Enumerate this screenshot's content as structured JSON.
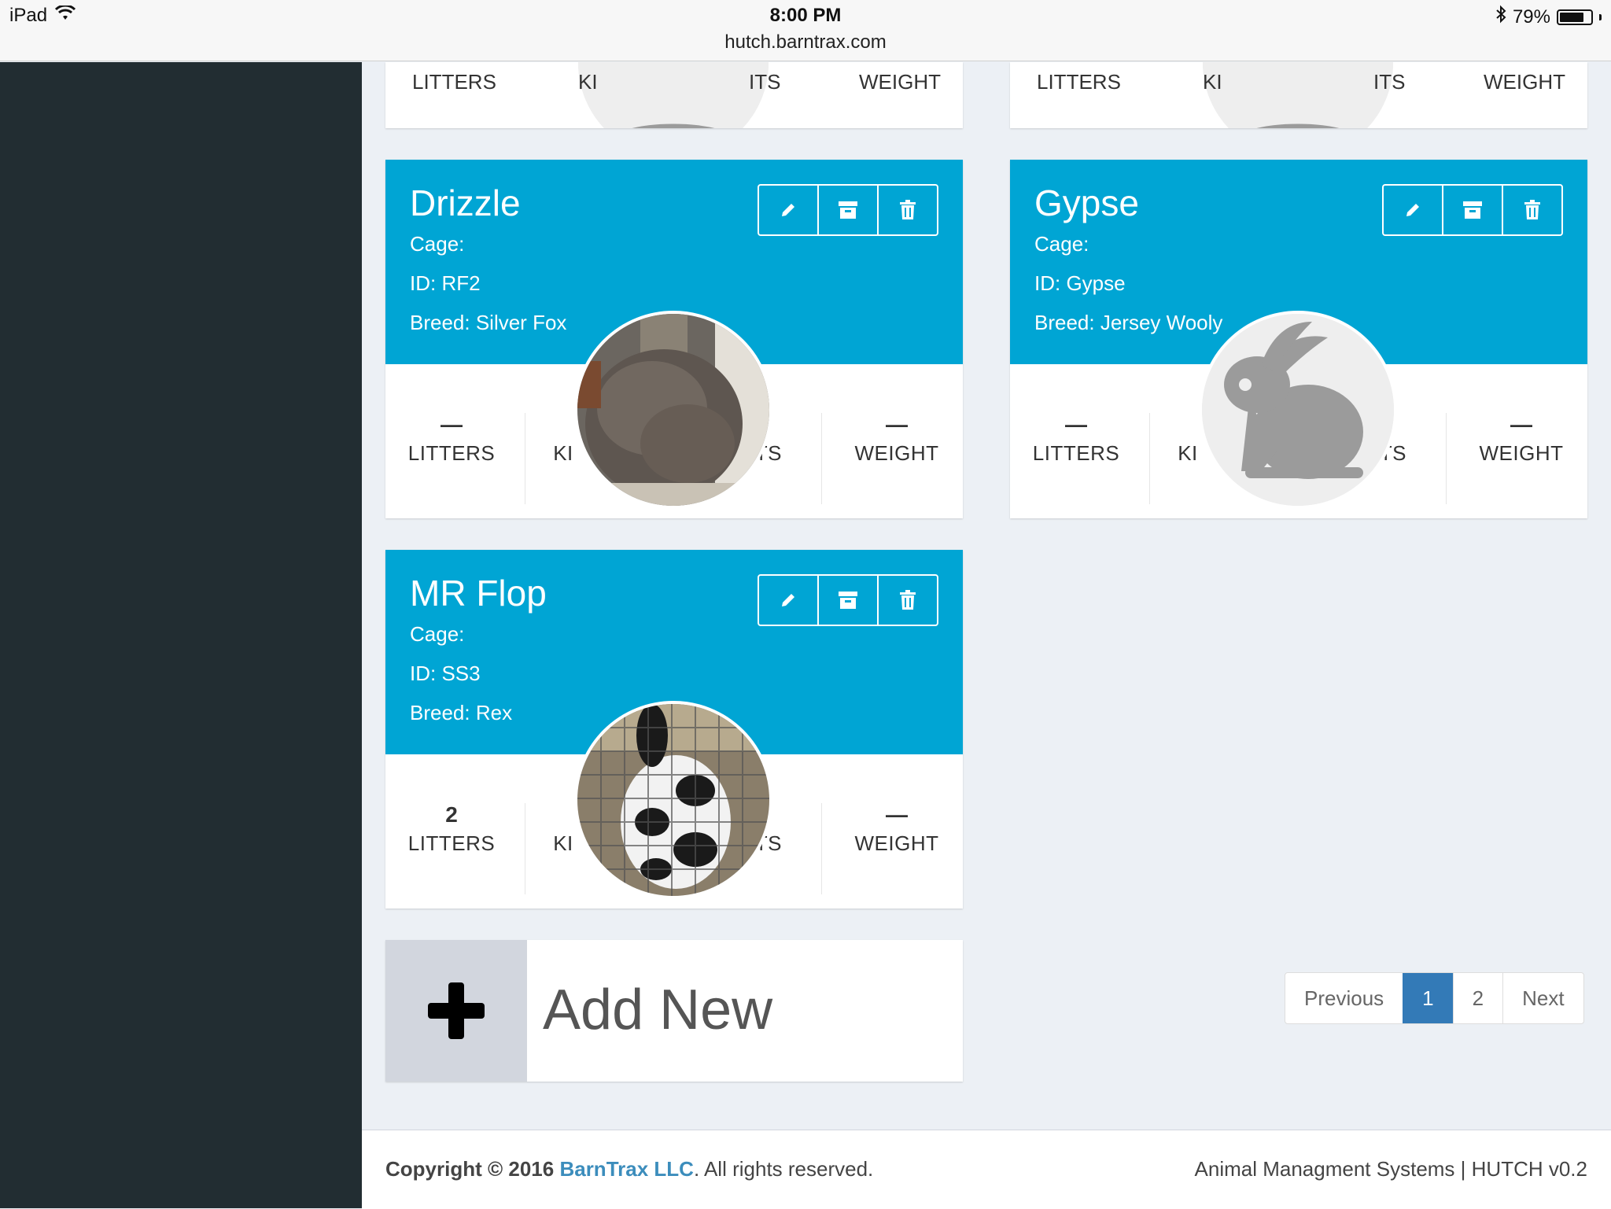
{
  "status_bar": {
    "device": "iPad",
    "time": "8:00 PM",
    "url": "hutch.barntrax.com",
    "battery_percent_label": "79%",
    "battery_level": 0.79
  },
  "stat_labels": {
    "litters": "LITTERS",
    "kits": "KITS",
    "weight": "WEIGHT"
  },
  "partial_cards": [
    {
      "litters": "LITTERS",
      "kits_left": "KI",
      "kits_right": "ITS",
      "weight": "WEIGHT"
    },
    {
      "litters": "LITTERS",
      "kits_left": "KI",
      "kits_right": "ITS",
      "weight": "WEIGHT"
    }
  ],
  "cards": [
    {
      "name": "Drizzle",
      "cage": "Cage:",
      "id": "ID: RF2",
      "breed": "Breed: Silver Fox",
      "litters_value": "—",
      "weight_value": "—",
      "kits_left": "KI",
      "kits_right": "ITS",
      "photo": "brown-fluffy-rabbit"
    },
    {
      "name": "Gypse",
      "cage": "Cage:",
      "id": "ID: Gypse",
      "breed": "Breed: Jersey Wooly",
      "litters_value": "—",
      "weight_value": "—",
      "kits_left": "KI",
      "kits_right": "ITS",
      "photo": "rabbit-placeholder-icon"
    },
    {
      "name": "MR Flop",
      "cage": "Cage:",
      "id": "ID: SS3",
      "breed": "Breed: Rex",
      "litters_value": "2",
      "weight_value": "—",
      "kits_left": "KI",
      "kits_right": "ITS",
      "photo": "black-white-rabbit-in-cage"
    }
  ],
  "add_new": {
    "label": "Add New"
  },
  "pagination": {
    "previous": "Previous",
    "pages": [
      "1",
      "2"
    ],
    "active": "1",
    "next": "Next"
  },
  "footer": {
    "copyright_prefix": "Copyright © 2016",
    "company": "BarnTrax LLC",
    "suffix": ". All rights reserved.",
    "right": "Animal Managment Systems | HUTCH v0.2"
  },
  "colors": {
    "card_header": "#00a5d4",
    "sidebar": "#222d32",
    "page_bg": "#ecf0f5",
    "pagination_active": "#337ab7"
  }
}
